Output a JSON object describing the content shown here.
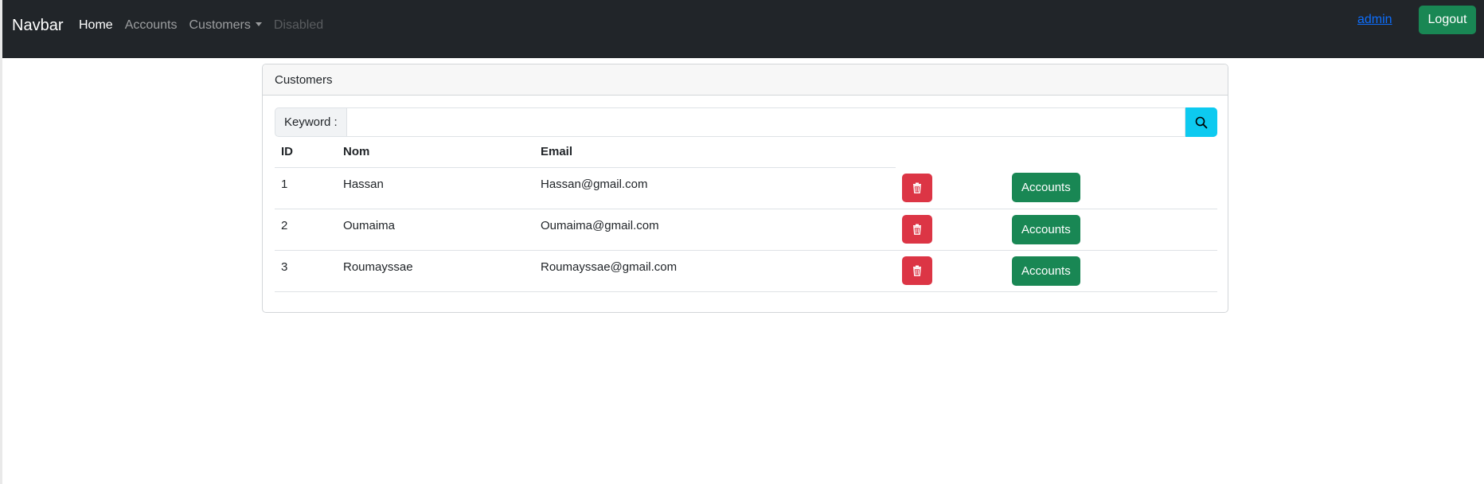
{
  "navbar": {
    "brand": "Navbar",
    "links": [
      {
        "label": "Home",
        "state": "active"
      },
      {
        "label": "Accounts",
        "state": "normal"
      },
      {
        "label": "Customers",
        "state": "dropdown"
      },
      {
        "label": "Disabled",
        "state": "disabled"
      }
    ],
    "user_link": "admin",
    "logout_label": "Logout"
  },
  "card": {
    "title": "Customers",
    "search": {
      "label": "Keyword :",
      "value": "",
      "button_icon": "search-icon"
    },
    "table": {
      "columns": [
        "ID",
        "Nom",
        "Email",
        "",
        ""
      ],
      "rows": [
        {
          "id": "1",
          "nom": "Hassan",
          "email": "Hassan@gmail.com",
          "delete_icon": "trash-icon",
          "accounts_label": "Accounts"
        },
        {
          "id": "2",
          "nom": "Oumaima",
          "email": "Oumaima@gmail.com",
          "delete_icon": "trash-icon",
          "accounts_label": "Accounts"
        },
        {
          "id": "3",
          "nom": "Roumayssae",
          "email": "Roumayssae@gmail.com",
          "delete_icon": "trash-icon",
          "accounts_label": "Accounts"
        }
      ]
    }
  },
  "colors": {
    "navbar_bg": "#212529",
    "success": "#198754",
    "danger": "#dc3545",
    "info": "#0dcaf0",
    "link": "#0d6efd"
  }
}
